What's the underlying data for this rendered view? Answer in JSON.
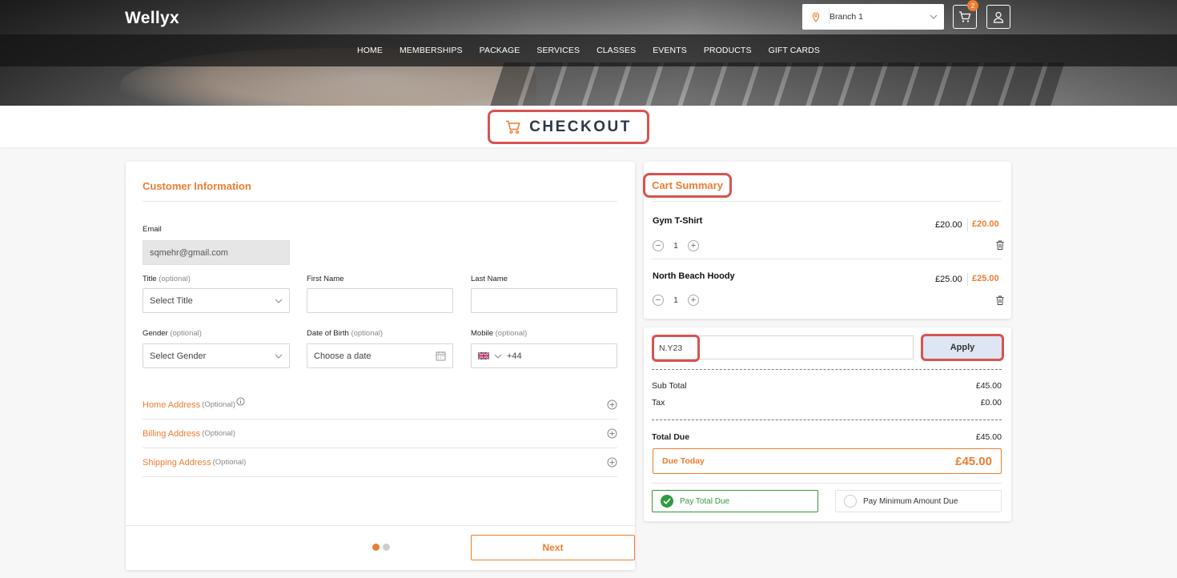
{
  "header": {
    "logo": "Wellyx",
    "branch": "Branch 1",
    "cart_count": "2",
    "nav": [
      "HOME",
      "MEMBERSHIPS",
      "PACKAGE",
      "SERVICES",
      "CLASSES",
      "EVENTS",
      "PRODUCTS",
      "GIFT CARDS"
    ]
  },
  "page_title": "CHECKOUT",
  "customer": {
    "title": "Customer Information",
    "email_label": "Email",
    "email_value": "sqmehr@gmail.com",
    "title_label": "Title",
    "title_opt": "(optional)",
    "title_placeholder": "Select Title",
    "first_name_label": "First Name",
    "last_name_label": "Last Name",
    "gender_label": "Gender",
    "gender_opt": "(optional)",
    "gender_placeholder": "Select Gender",
    "dob_label": "Date of Birth",
    "dob_opt": "(optional)",
    "dob_placeholder": "Choose a date",
    "mobile_label": "Mobile",
    "mobile_opt": "(optional)",
    "mobile_code": "+44",
    "addresses": [
      {
        "name": "Home Address",
        "opt": "(Optional)"
      },
      {
        "name": "Billing Address",
        "opt": "(Optional)"
      },
      {
        "name": "Shipping Address",
        "opt": "(Optional)"
      }
    ],
    "next_label": "Next"
  },
  "cart": {
    "title": "Cart Summary",
    "items": [
      {
        "name": "Gym T-Shirt",
        "price": "£20.00",
        "total": "£20.00",
        "qty": "1"
      },
      {
        "name": "North Beach Hoody",
        "price": "£25.00",
        "total": "£25.00",
        "qty": "1"
      }
    ]
  },
  "payment": {
    "promo_code": "N.Y23",
    "apply_label": "Apply",
    "subtotal_label": "Sub Total",
    "subtotal_value": "£45.00",
    "tax_label": "Tax",
    "tax_value": "£0.00",
    "total_due_label": "Total Due",
    "total_due_value": "£45.00",
    "due_today_label": "Due Today",
    "due_today_value": "£45.00",
    "pay_total_label": "Pay Total Due",
    "pay_min_label": "Pay Minimum Amount Due"
  },
  "colors": {
    "accent": "#ed7d31",
    "highlight": "#d9534f",
    "success": "#2e9b3f"
  }
}
